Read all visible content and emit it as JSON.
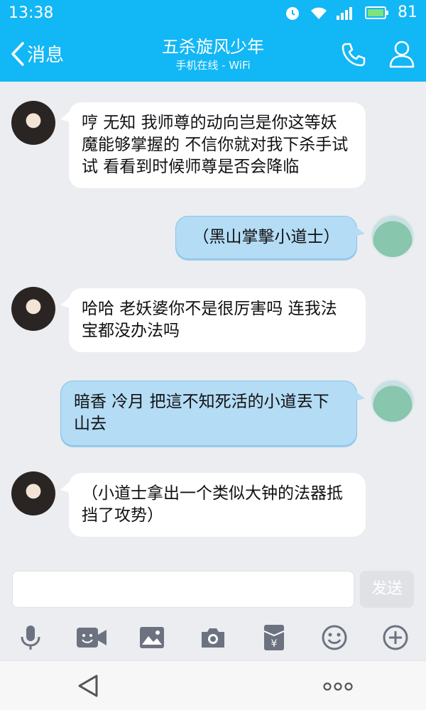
{
  "status": {
    "time": "13:38",
    "battery": "81"
  },
  "header": {
    "back_label": "消息",
    "title": "五杀旋风少年",
    "subtitle": "手机在线 - WiFi"
  },
  "messages": [
    {
      "side": "in",
      "text": "哼 无知 我师尊的动向岂是你这等妖魔能够掌握的 不信你就对我下杀手试试 看看到时候师尊是否会降临"
    },
    {
      "side": "out",
      "text": "（黑山掌擊小道士）"
    },
    {
      "side": "in",
      "text": "哈哈 老妖婆你不是很厉害吗 连我法宝都没办法吗"
    },
    {
      "side": "out",
      "text": "暗香 冷月 把這不知死活的小道丟下山去"
    },
    {
      "side": "in",
      "text": "（小道士拿出一个类似大钟的法器抵挡了攻势）"
    }
  ],
  "input": {
    "placeholder": "",
    "send_label": "发送"
  },
  "toolbar_icons": [
    "mic-icon",
    "video-icon",
    "image-icon",
    "camera-icon",
    "red-packet-icon",
    "emoji-icon",
    "plus-icon"
  ],
  "colors": {
    "header": "#12b7f5",
    "outgoing_bubble": "#b4dcf5",
    "background": "#ebedf0"
  }
}
